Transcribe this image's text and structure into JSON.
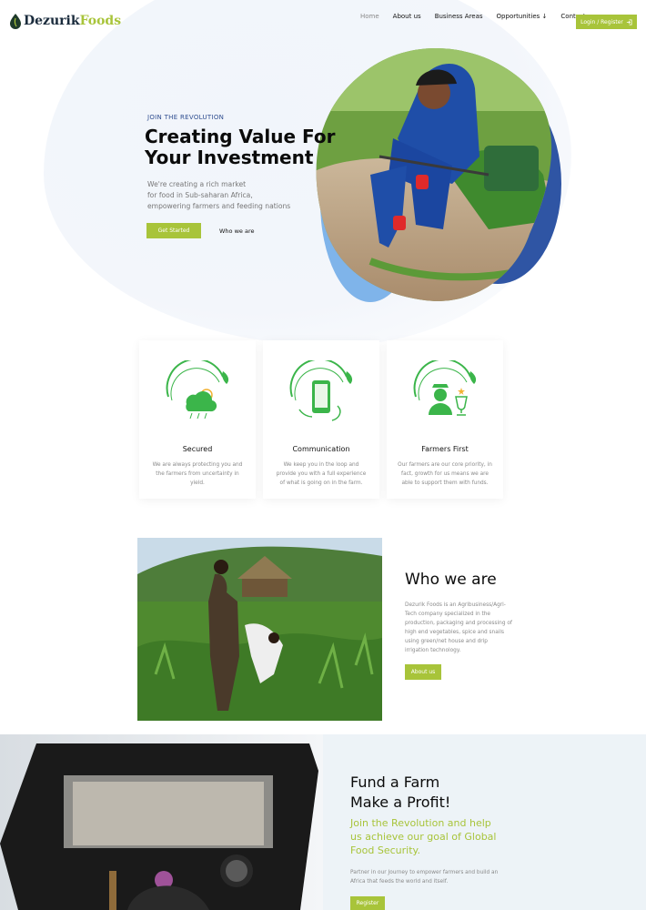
{
  "brand": {
    "name_dark": "Dezurik",
    "name_accent": "Foods",
    "accent_color": "#a8c43a",
    "navy_color": "#2e4c8f"
  },
  "nav": {
    "items": [
      {
        "label": "Home",
        "active": true
      },
      {
        "label": "About us"
      },
      {
        "label": "Business Areas"
      },
      {
        "label": "Opportunities ↓"
      },
      {
        "label": "Contact us"
      }
    ],
    "login_label": "Login / Register",
    "login_icon": "sign-in-icon"
  },
  "hero": {
    "kicker": "JOIN THE REVOLUTION",
    "title_line1": "Creating Value For",
    "title_line2": "Your Investment",
    "desc_line1": "We're creating a rich market",
    "desc_line2": "for food in Sub-saharan Africa,",
    "desc_line3": "empowering farmers and feeding nations",
    "cta_primary": "Get Started",
    "cta_secondary": "Who we are"
  },
  "features": [
    {
      "title": "Secured",
      "text": "We are always protecting you and the farmers from uncertainty in yield.",
      "icon": "weather-shield-icon"
    },
    {
      "title": "Communication",
      "text": "We keep you in the loop and provide you with a full experience of what is going on in the farm.",
      "icon": "phone-icon"
    },
    {
      "title": "Farmers First",
      "text": "Our farmers are our core priority, in fact, growth for us means we are able to support them with funds.",
      "icon": "farmer-trophy-icon"
    }
  ],
  "who": {
    "title": "Who we are",
    "text": "Dezurik Foods is an Agribusiness/Agri-Tech company specialized in the production, packaging and processing of high end vegetables, spice and snails using green/net house and drip irrigation technology.",
    "button": "About us"
  },
  "fund": {
    "title_line1": "Fund a Farm",
    "title_line2": "Make a Profit!",
    "subtitle": "Join the Revolution and help us achieve our goal of Global Food Security.",
    "text": "Partner in our Journey to empower farmers and build an Africa that feeds the world and itself.",
    "button": "Register"
  }
}
